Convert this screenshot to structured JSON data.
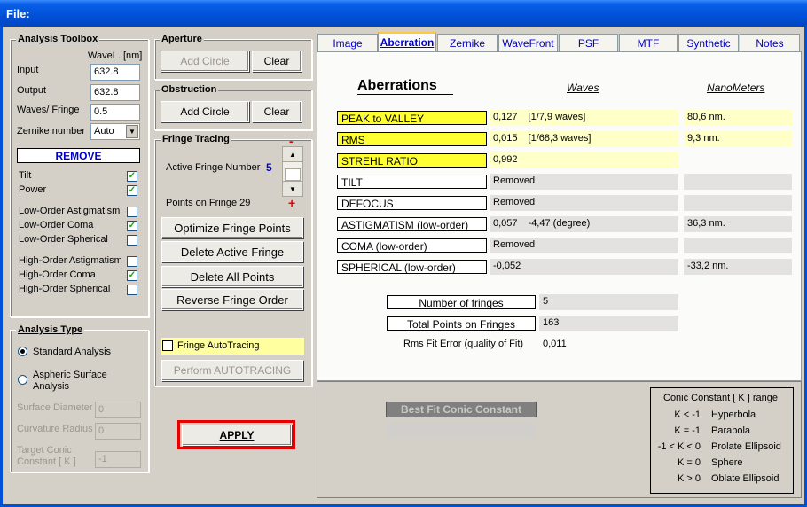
{
  "window": {
    "title": "File:"
  },
  "toolbox": {
    "title": "Analysis Toolbox",
    "wavel_header": "WaveL. [nm]",
    "input_label": "Input",
    "input_value": "632.8",
    "output_label": "Output",
    "output_value": "632.8",
    "waves_label": "Waves/ Fringe",
    "waves_value": "0.5",
    "zernike_label": "Zernike number",
    "zernike_value": "Auto",
    "remove_label": "REMOVE",
    "terms": [
      {
        "label": "Tilt",
        "checked": true
      },
      {
        "label": "Power",
        "checked": true
      },
      {
        "label": "Low-Order Astigmatism",
        "checked": false
      },
      {
        "label": "Low-Order Coma",
        "checked": true
      },
      {
        "label": "Low-Order Spherical",
        "checked": false
      },
      {
        "label": "High-Order Astigmatism",
        "checked": false
      },
      {
        "label": "High-Order Coma",
        "checked": true
      },
      {
        "label": "High-Order Spherical",
        "checked": false
      }
    ]
  },
  "analysis_type": {
    "title": "Analysis Type",
    "standard": "Standard Analysis",
    "aspheric_line1": "Aspheric  Surface",
    "aspheric_line2": "Analysis",
    "surface_diameter_label": "Surface Diameter",
    "surface_diameter_value": "0",
    "curvature_radius_label": "Curvature Radius",
    "curvature_radius_value": "0",
    "target_conic_line1": "Target Conic",
    "target_conic_line2": "Constant [ K ]",
    "target_conic_value": "-1"
  },
  "aperture": {
    "title": "Aperture",
    "add_label": "Add Circle",
    "clear_label": "Clear"
  },
  "obstruction": {
    "title": "Obstruction",
    "add_label": "Add Circle",
    "clear_label": "Clear"
  },
  "fringe": {
    "title": "Fringe Tracing",
    "active_label": "Active Fringe Number",
    "active_value": "5",
    "points_label": "Points on  Fringe 29",
    "minus": "-",
    "plus": "+",
    "optimize": "Optimize Fringe Points",
    "delete_active": "Delete Active Fringe",
    "delete_all": "Delete  All  Points",
    "reverse": "Reverse  Fringe Order",
    "autotracing_label": "Fringe AutoTracing",
    "perform_label": "Perform  AUTOTRACING"
  },
  "apply_label": "APPLY",
  "tabs": [
    "Image",
    "Aberration",
    "Zernike",
    "WaveFront",
    "PSF",
    "MTF",
    "Synthetic",
    "Notes"
  ],
  "aberrations": {
    "title": "Aberrations",
    "col_waves": "Waves",
    "col_nm": "NanoMeters",
    "rows": [
      {
        "name": "PEAK to VALLEY",
        "waves": "0,127",
        "extra": "[1/7,9 waves]",
        "nm": "80,6  nm."
      },
      {
        "name": "RMS",
        "waves": "0,015",
        "extra": "[1/68,3 waves]",
        "nm": "9,3  nm."
      },
      {
        "name": "STREHL   RATIO",
        "waves": "0,992",
        "extra": "",
        "nm": ""
      },
      {
        "name": "TILT",
        "waves": "Removed",
        "extra": "",
        "nm": ""
      },
      {
        "name": "DEFOCUS",
        "waves": "Removed",
        "extra": "",
        "nm": ""
      },
      {
        "name": "ASTIGMATISM  (low-order)",
        "waves": "0,057",
        "extra": "-4,47  (degree)",
        "nm": "36,3  nm."
      },
      {
        "name": "COMA            (low-order)",
        "waves": "Removed",
        "extra": "",
        "nm": ""
      },
      {
        "name": "SPHERICAL     (low-order)",
        "waves": "-0,052",
        "extra": "",
        "nm": "-33,2  nm."
      }
    ],
    "num_fringes_label": "Number of fringes",
    "num_fringes_value": "5",
    "total_points_label": "Total  Points on Fringes",
    "total_points_value": "163",
    "rms_fit_label": "Rms Fit Error (quality of Fit)",
    "rms_fit_value": "0,011"
  },
  "conic": {
    "best_fit_label": "Best Fit Conic Constant",
    "legend_title": "Conic Constant [ K ]  range",
    "legend": [
      {
        "cond": "K < -1",
        "name": "Hyperbola"
      },
      {
        "cond": "K = -1",
        "name": "Parabola"
      },
      {
        "cond": "-1 < K < 0",
        "name": "Prolate Ellipsoid"
      },
      {
        "cond": "K =  0",
        "name": "Sphere"
      },
      {
        "cond": "K > 0",
        "name": "Oblate Ellipsoid"
      }
    ]
  },
  "colors": {
    "titlebar": "#0050d8",
    "highlight": "#ffff32",
    "apply_border": "#e60000",
    "tab_text": "#0000c8"
  }
}
